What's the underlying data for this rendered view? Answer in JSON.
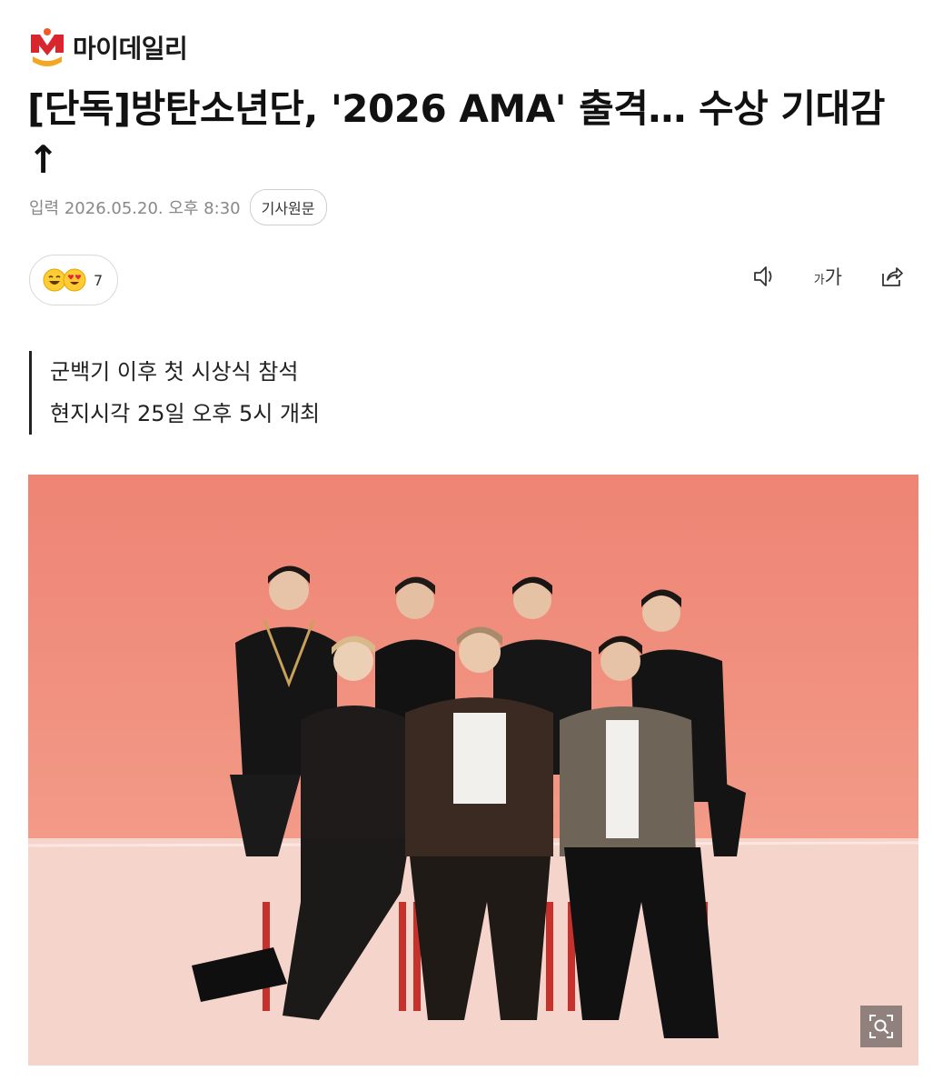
{
  "brand": {
    "name": "마이데일리"
  },
  "article": {
    "headline": "[단독]방탄소년단, '2026 AMA' 출격… 수상 기대감↑",
    "published": "입력 2026.05.20. 오후 8:30",
    "source_button": "기사원문",
    "reactions": {
      "count": "7",
      "icons": [
        "grinning-face-icon",
        "heart-eyes-face-icon"
      ]
    },
    "tools": [
      "speaker-icon",
      "font-size-icon",
      "share-icon"
    ],
    "font_size_small": "가",
    "font_size_large": "가",
    "summary": [
      "군백기 이후 첫 시상식 참석",
      "현지시각 25일 오후 5시 개최"
    ],
    "photo": {
      "icon": "zoom-icon"
    }
  },
  "colors": {
    "brand_orange": "#f05a28",
    "brand_red": "#d9262e",
    "photo_backdrop": "#ef8a7a",
    "chair_red": "#c7312c"
  }
}
